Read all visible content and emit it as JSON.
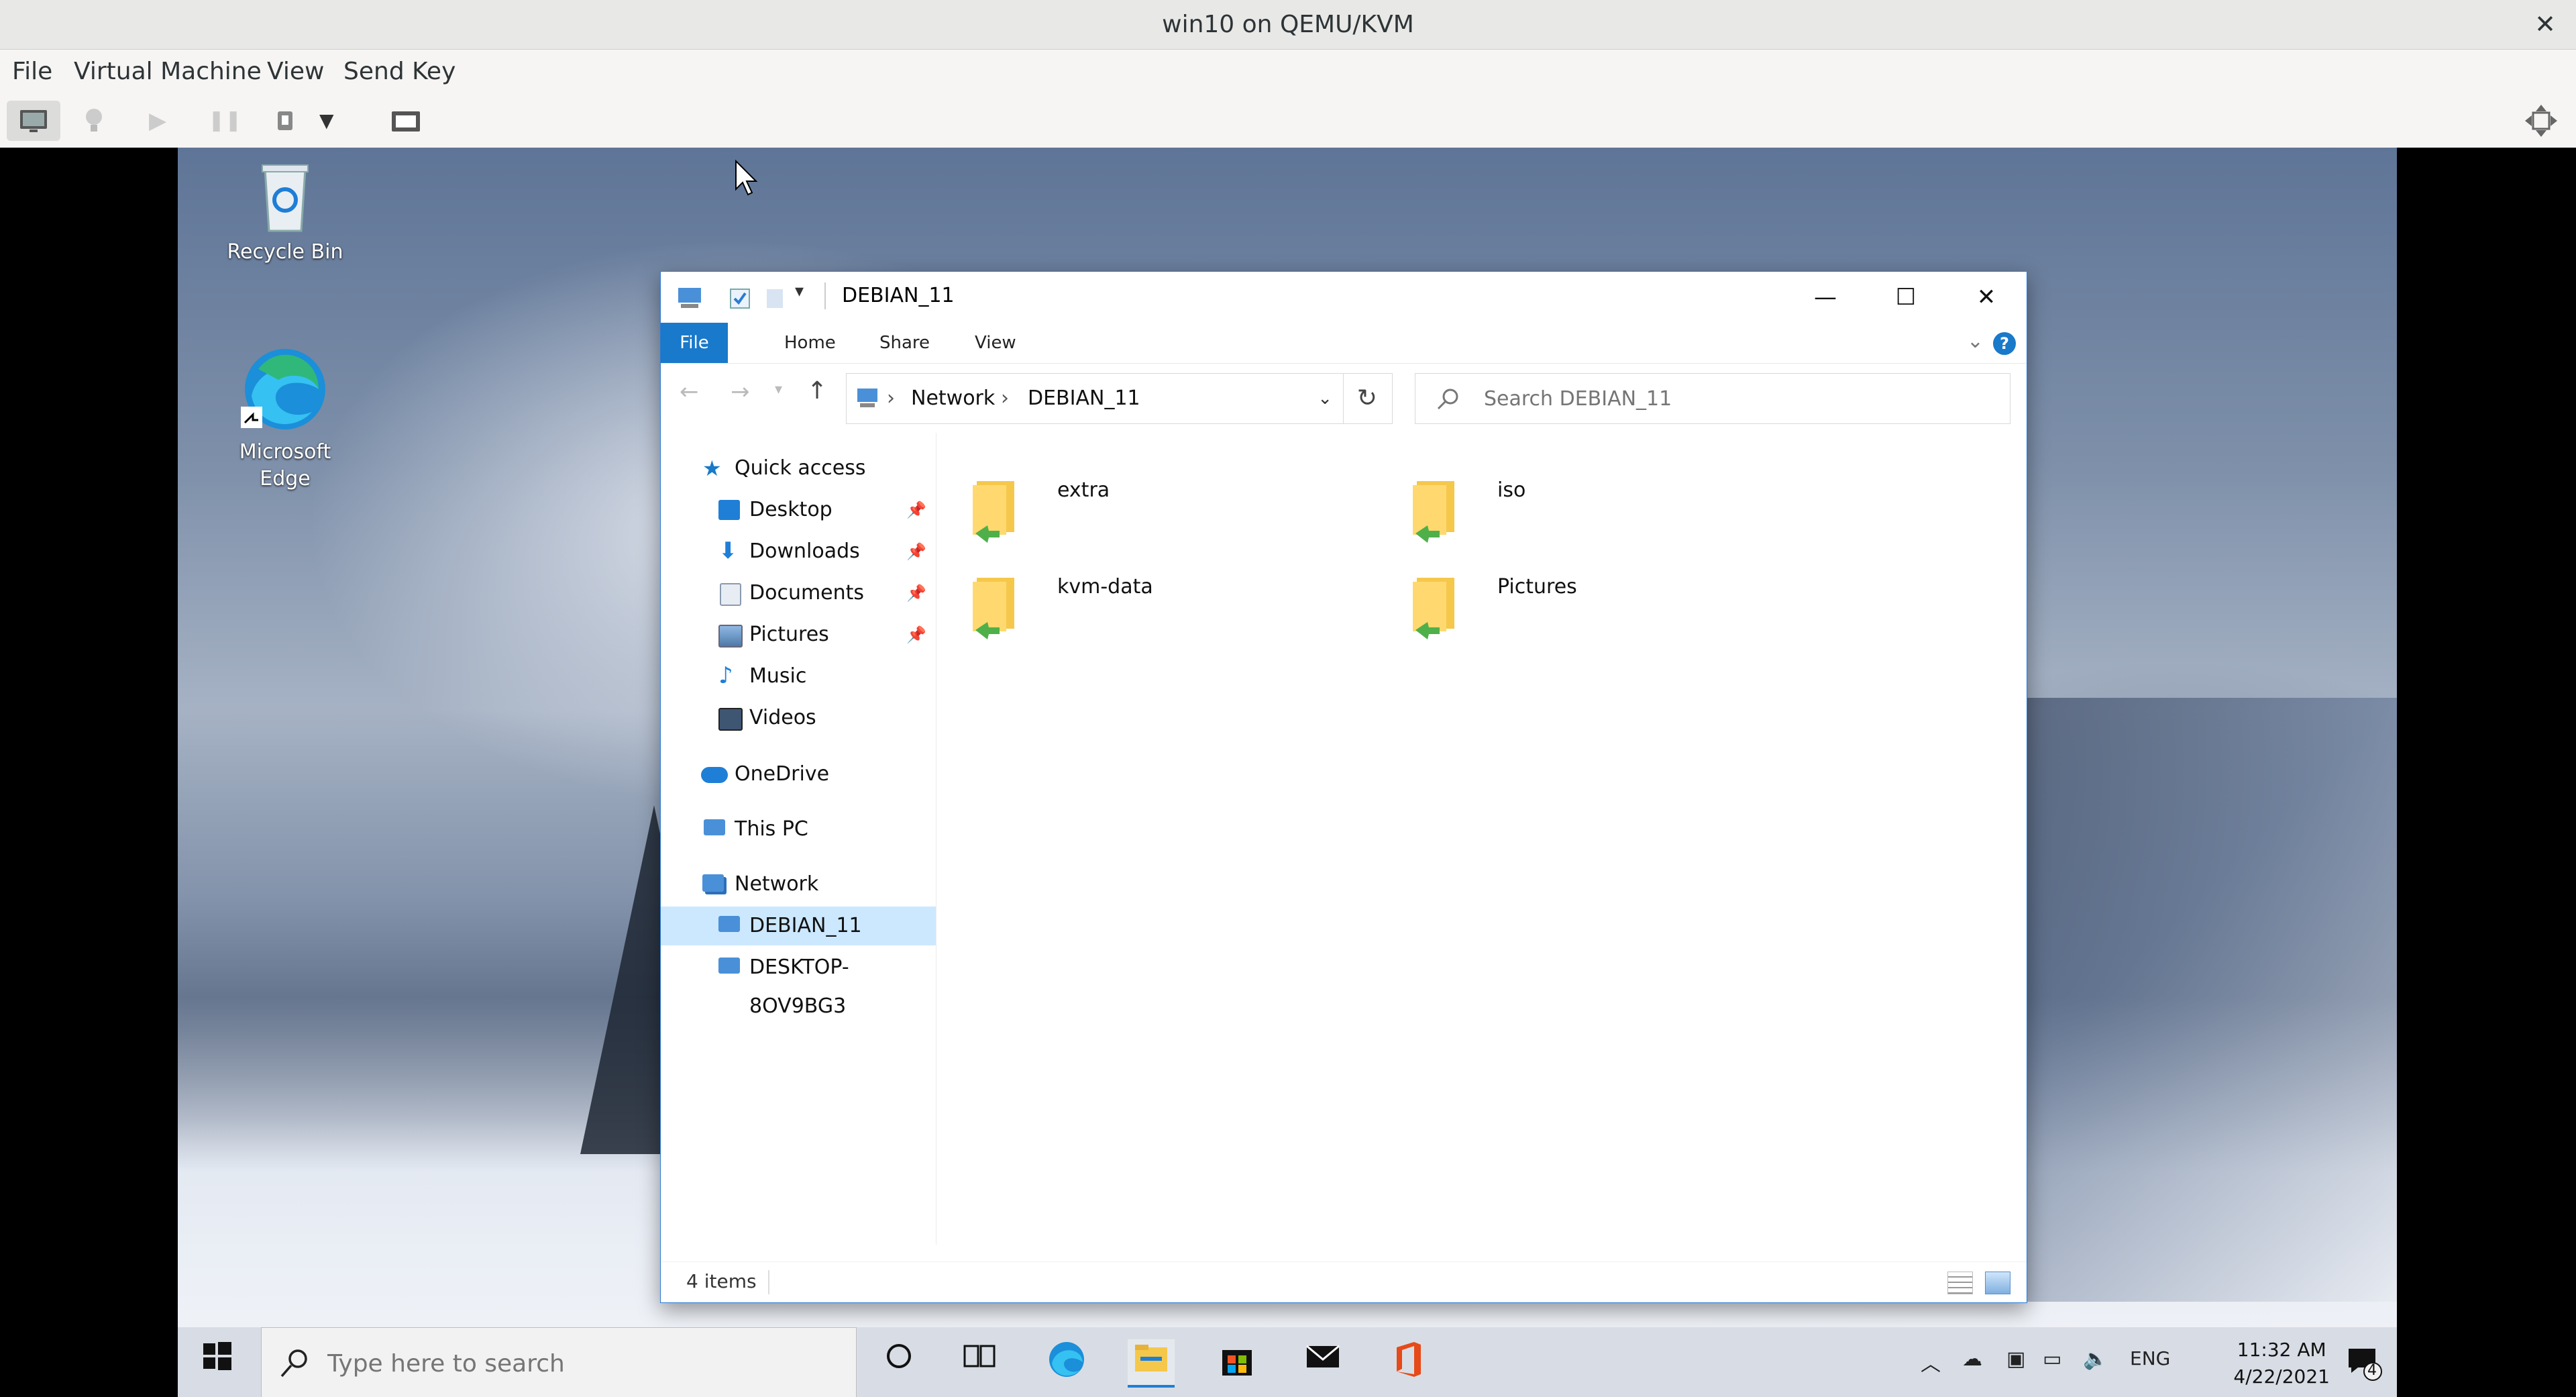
{
  "host": {
    "title": "win10 on QEMU/KVM",
    "menu": [
      "File",
      "Virtual Machine",
      "View",
      "Send Key"
    ]
  },
  "desktop": {
    "icons": [
      {
        "label": "Recycle Bin"
      },
      {
        "label": "Microsoft Edge"
      }
    ]
  },
  "explorer": {
    "title": "DEBIAN_11",
    "ribbon_tabs": [
      "File",
      "Home",
      "Share",
      "View"
    ],
    "breadcrumb": [
      "Network",
      "DEBIAN_11"
    ],
    "search_placeholder": "Search DEBIAN_11",
    "nav": {
      "quick_access": "Quick access",
      "items": [
        {
          "label": "Desktop",
          "pinned": true
        },
        {
          "label": "Downloads",
          "pinned": true
        },
        {
          "label": "Documents",
          "pinned": true
        },
        {
          "label": "Pictures",
          "pinned": true
        },
        {
          "label": "Music",
          "pinned": false
        },
        {
          "label": "Videos",
          "pinned": false
        }
      ],
      "onedrive": "OneDrive",
      "this_pc": "This PC",
      "network": "Network",
      "network_items": [
        "DEBIAN_11",
        "DESKTOP-8OV9BG3"
      ]
    },
    "folders": [
      "extra",
      "iso",
      "kvm-data",
      "Pictures"
    ],
    "status": "4 items"
  },
  "taskbar": {
    "search_placeholder": "Type here to search",
    "lang": "ENG",
    "time": "11:32 AM",
    "date": "4/22/2021",
    "notifications": "4"
  }
}
